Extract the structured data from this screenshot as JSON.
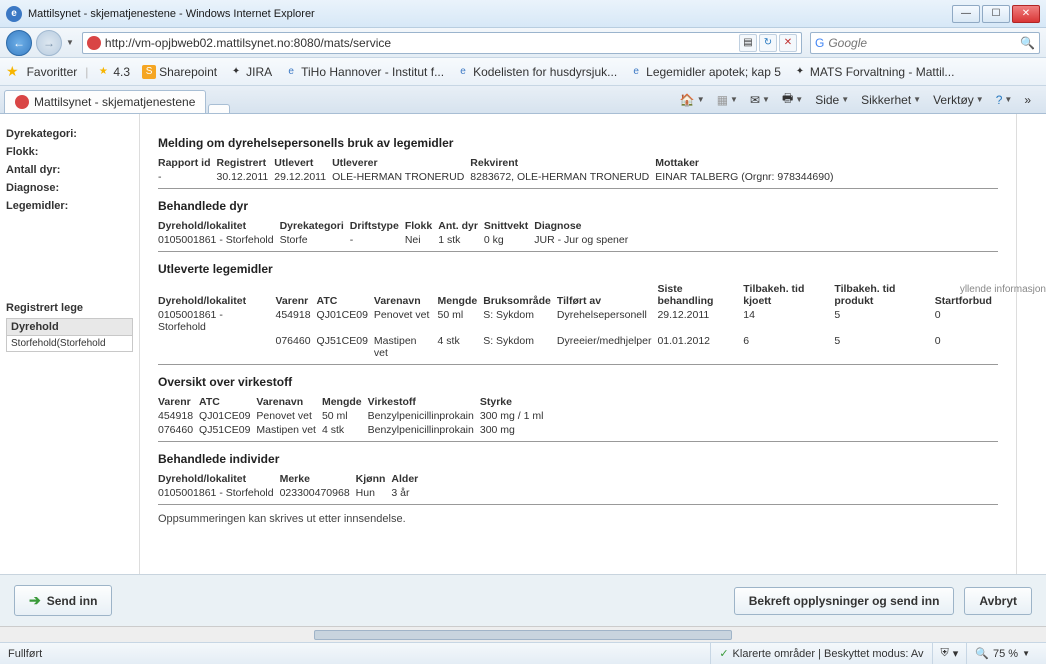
{
  "window": {
    "title": "Mattilsynet - skjematjenestene - Windows Internet Explorer",
    "url": "http://vm-opjbweb02.mattilsynet.no:8080/mats/service",
    "search_placeholder": "Google"
  },
  "favorites": {
    "label": "Favoritter",
    "items": [
      "4.3",
      "Sharepoint",
      "JIRA",
      "TiHo Hannover - Institut f...",
      "Kodelisten for husdyrsjuk...",
      "Legemidler apotek; kap 5",
      "MATS Forvaltning - Mattil..."
    ]
  },
  "tab": {
    "title": "Mattilsynet - skjematjenestene"
  },
  "cmdbar": {
    "side": "Side",
    "sikkerhet": "Sikkerhet",
    "verktoy": "Verktøy"
  },
  "left": {
    "labels": [
      "Dyrekategori:",
      "Flokk:",
      "Antall dyr:",
      "Diagnose:",
      "Legemidler:"
    ],
    "reglege": "Registrert lege",
    "dyrehold": "Dyrehold",
    "dyrehold_val": "Storfehold(Storfehold"
  },
  "page": {
    "h1": "Melding om dyrehelsepersonells bruk av legemidler",
    "rapport": {
      "headers": [
        "Rapport id",
        "Registrert",
        "Utlevert",
        "Utleverer",
        "Rekvirent",
        "Mottaker"
      ],
      "row": [
        "-",
        "30.12.2011",
        "29.12.2011",
        "OLE-HERMAN TRONERUD",
        "8283672, OLE-HERMAN TRONERUD",
        "EINAR TALBERG (Orgnr: 978344690)"
      ]
    },
    "behandlede_dyr": {
      "title": "Behandlede dyr",
      "headers": [
        "Dyrehold/lokalitet",
        "Dyrekategori",
        "Driftstype",
        "Flokk",
        "Ant. dyr",
        "Snittvekt",
        "Diagnose"
      ],
      "row": [
        "0105001861 - Storfehold",
        "Storfe",
        "-",
        "Nei",
        "1 stk",
        "0 kg",
        "JUR - Jur og spener"
      ]
    },
    "utleverte": {
      "title": "Utleverte legemidler",
      "headers": [
        "Dyrehold/lokalitet",
        "Varenr",
        "ATC",
        "Varenavn",
        "Mengde",
        "Bruksområde",
        "Tilført av",
        "Siste behandling",
        "Tilbakeh. tid kjoett",
        "Tilbakeh. tid produkt",
        "Startforbud"
      ],
      "rows": [
        [
          "0105001861 - Storfehold",
          "454918",
          "QJ01CE09",
          "Penovet vet",
          "50 ml",
          "S: Sykdom",
          "Dyrehelsepersonell",
          "29.12.2011",
          "14",
          "5",
          "0"
        ],
        [
          "",
          "076460",
          "QJ51CE09",
          "Mastipen vet",
          "4 stk",
          "S: Sykdom",
          "Dyreeier/medhjelper",
          "01.01.2012",
          "6",
          "5",
          "0"
        ]
      ]
    },
    "virkestoff": {
      "title": "Oversikt over virkestoff",
      "headers": [
        "Varenr",
        "ATC",
        "Varenavn",
        "Mengde",
        "Virkestoff",
        "Styrke"
      ],
      "rows": [
        [
          "454918",
          "QJ01CE09",
          "Penovet vet",
          "50 ml",
          "Benzylpenicillinprokain",
          "300 mg / 1 ml"
        ],
        [
          "076460",
          "QJ51CE09",
          "Mastipen vet",
          "4 stk",
          "Benzylpenicillinprokain",
          "300 mg"
        ]
      ]
    },
    "individer": {
      "title": "Behandlede individer",
      "headers": [
        "Dyrehold/lokalitet",
        "Merke",
        "Kjønn",
        "Alder"
      ],
      "row": [
        "0105001861 - Storfehold",
        "023300470968",
        "Hun",
        "3 år"
      ]
    },
    "note": "Oppsummeringen kan skrives ut etter innsendelse.",
    "hint": "yllende informasjon"
  },
  "buttons": {
    "send": "Send inn",
    "confirm": "Bekreft opplysninger og send inn",
    "cancel": "Avbryt"
  },
  "status": {
    "left": "Fullført",
    "trust": "Klarerte områder | Beskyttet modus: Av",
    "zoom": "75 %"
  }
}
